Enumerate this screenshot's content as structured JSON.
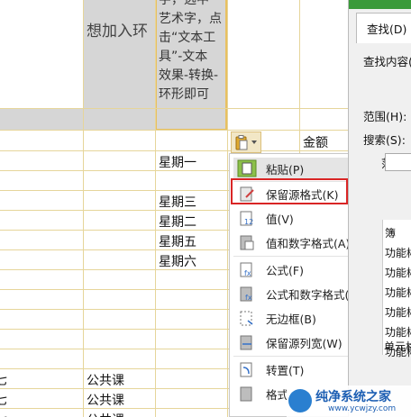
{
  "sheet": {
    "header_col_b": "想加入环",
    "note_lines": [
      "字，选中",
      "艺术字，点",
      "击“文本工",
      "具”-文本",
      "效果-转换-",
      "环形即可"
    ],
    "col_e_header": "金额",
    "weekdays": [
      "星期一",
      "星期三",
      "星期二",
      "星期五",
      "星期六"
    ],
    "col_a_fragment": "七",
    "course_type": "公共课"
  },
  "context_menu": {
    "items": [
      {
        "label": "粘贴(P)",
        "icon": "paste-icon"
      },
      {
        "label": "保留源格式(K)",
        "icon": "keep-source-format-icon"
      },
      {
        "label": "值(V)",
        "icon": "paste-values-icon"
      },
      {
        "label": "值和数字格式(A)",
        "icon": "values-number-format-icon"
      },
      {
        "label": "公式(F)",
        "icon": "formula-icon"
      },
      {
        "label": "公式和数字格式(O)",
        "icon": "formula-number-format-icon"
      },
      {
        "label": "无边框(B)",
        "icon": "no-border-icon"
      },
      {
        "label": "保留源列宽(W)",
        "icon": "keep-column-width-icon"
      },
      {
        "label": "转置(T)",
        "icon": "transpose-icon"
      },
      {
        "label": "格式",
        "icon": "format-icon"
      }
    ]
  },
  "find_dialog": {
    "tab_find": "查找(D)",
    "find_what_label": "查找内容(",
    "scope_label": "范围(H):",
    "search_label": "搜索(S):",
    "range_label": "范围",
    "result_header": "簿",
    "result_rows": [
      "功能彬",
      "功能彬",
      "功能彬",
      "功能彬",
      "功能彬",
      "功能彬",
      "单元格"
    ]
  },
  "watermark": {
    "title": "纯净系统之家",
    "url": "www.ycwjzy.com"
  },
  "colors": {
    "grid": "#e6d59a",
    "menu_highlight": "#e5e5e5",
    "red_box": "#d92525",
    "header_fill": "#d6d6d6"
  }
}
